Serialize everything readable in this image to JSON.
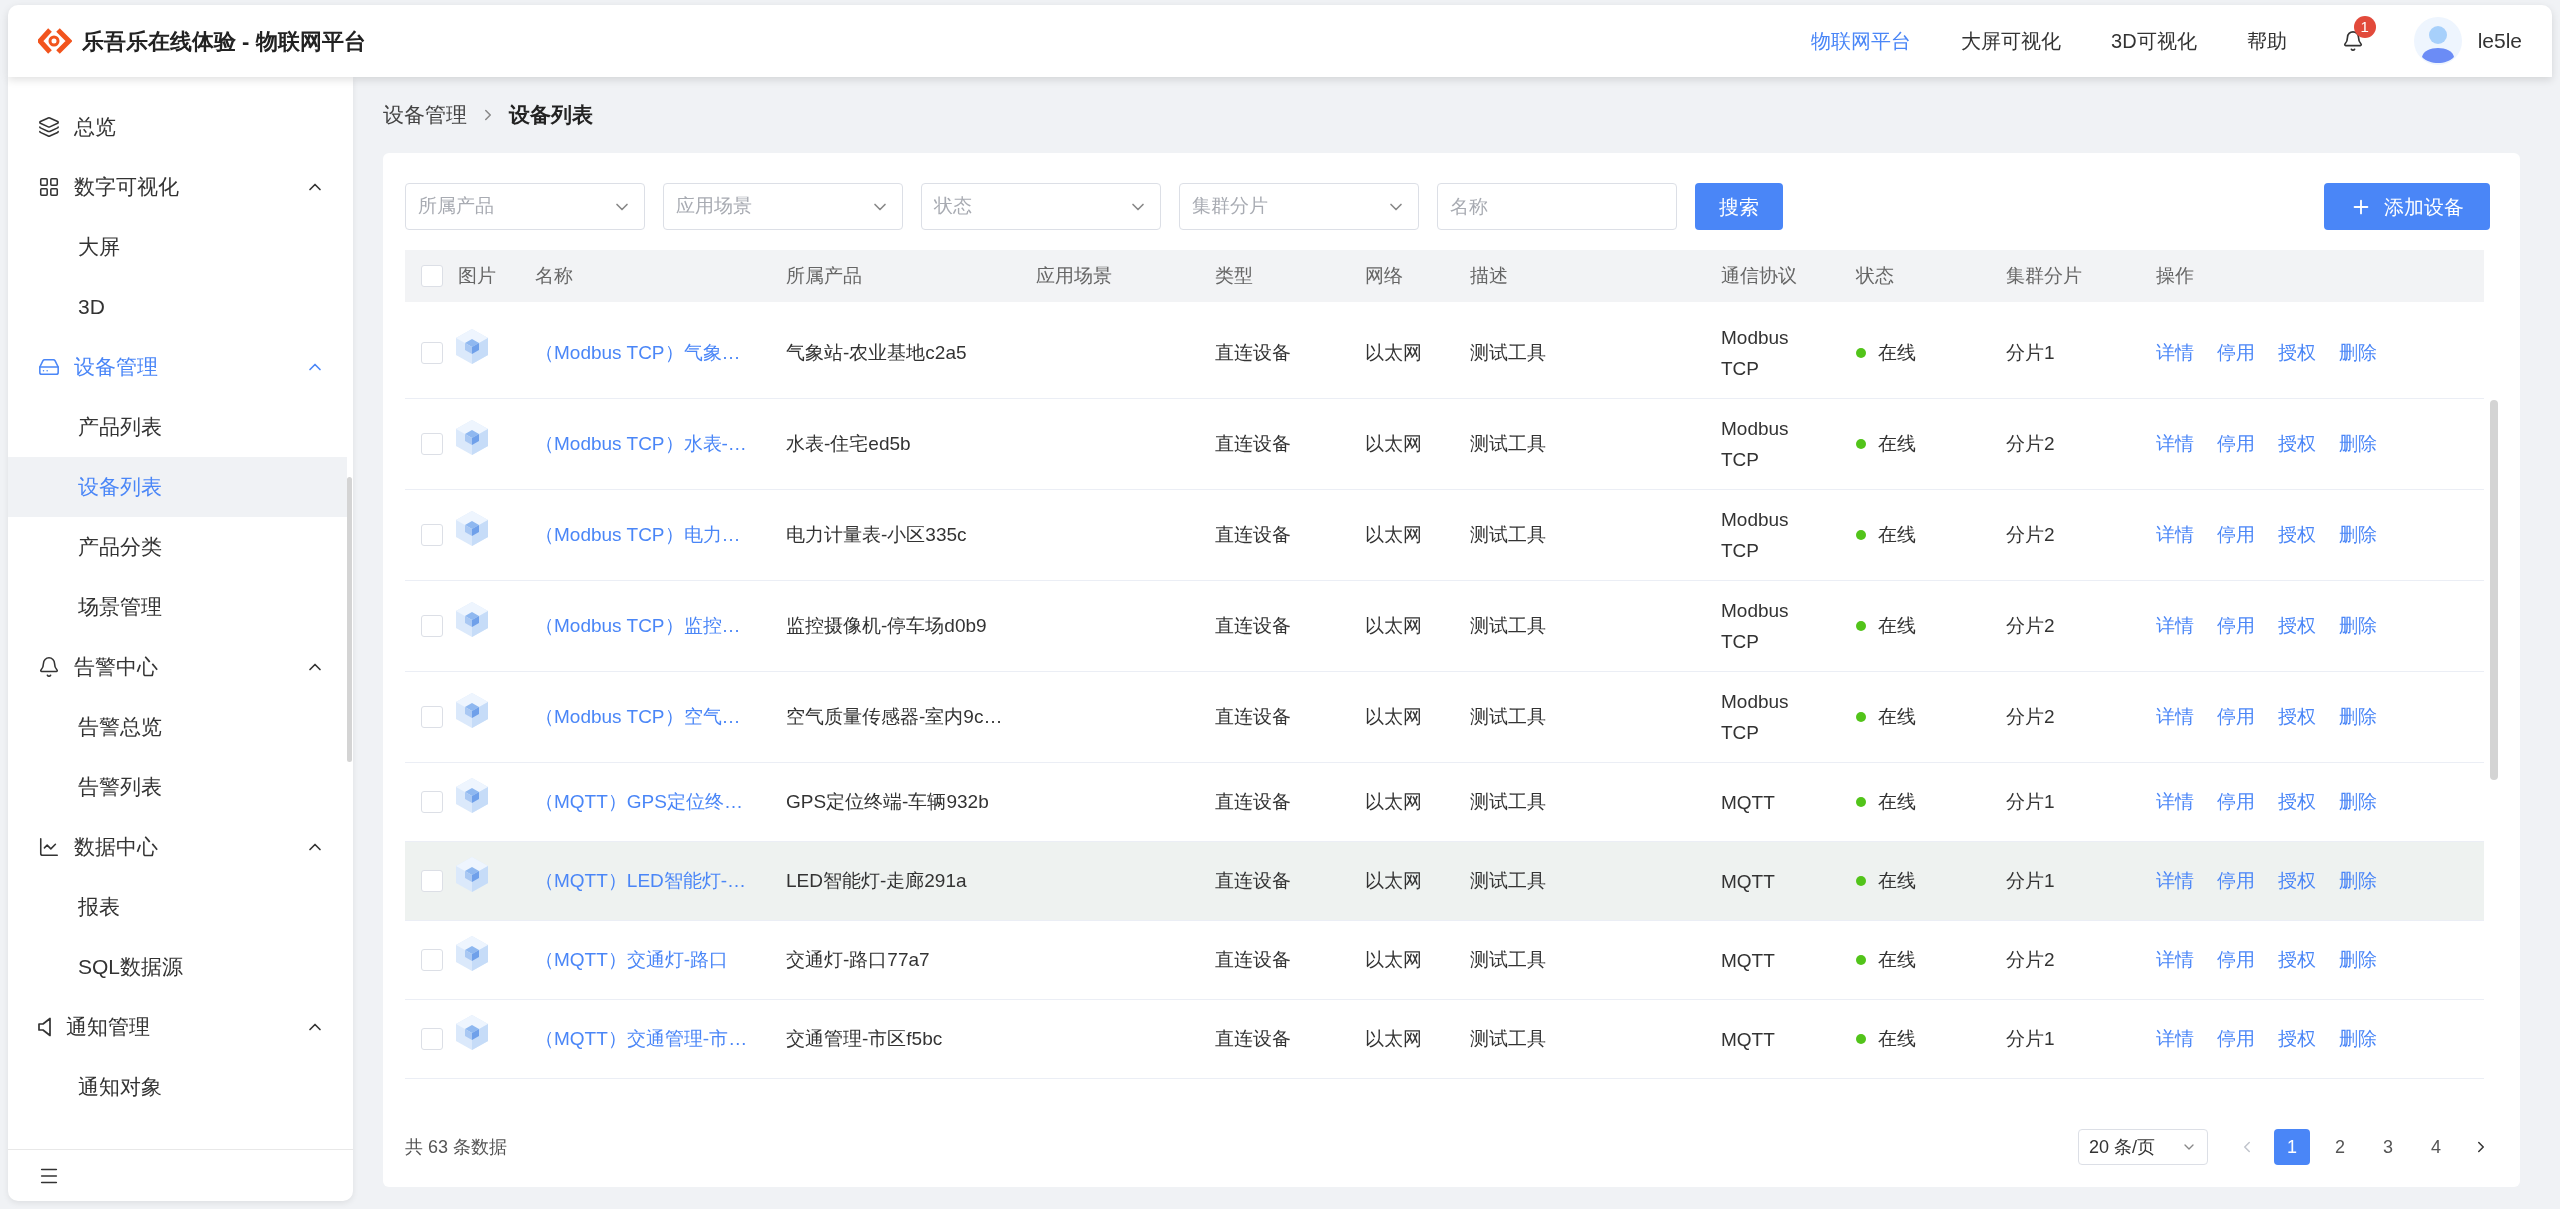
{
  "header": {
    "title": "乐吾乐在线体验 - 物联网平台",
    "nav": [
      {
        "label": "物联网平台",
        "selected": true
      },
      {
        "label": "大屏可视化",
        "selected": false
      },
      {
        "label": "3D可视化",
        "selected": false
      },
      {
        "label": "帮助",
        "selected": false
      }
    ],
    "notifications": "1",
    "user": "le5le"
  },
  "sidebar": {
    "items": [
      {
        "label": "总览",
        "selected": false
      },
      {
        "label": "数字可视化",
        "expanded": true,
        "selected": false,
        "children": [
          {
            "label": "大屏",
            "selected": false
          },
          {
            "label": "3D",
            "selected": false
          }
        ]
      },
      {
        "label": "设备管理",
        "expanded": true,
        "selected": true,
        "children": [
          {
            "label": "产品列表",
            "selected": false
          },
          {
            "label": "设备列表",
            "selected": true
          },
          {
            "label": "产品分类",
            "selected": false
          },
          {
            "label": "场景管理",
            "selected": false
          }
        ]
      },
      {
        "label": "告警中心",
        "expanded": true,
        "selected": false,
        "children": [
          {
            "label": "告警总览",
            "selected": false
          },
          {
            "label": "告警列表",
            "selected": false
          }
        ]
      },
      {
        "label": "数据中心",
        "expanded": true,
        "selected": false,
        "children": [
          {
            "label": "报表",
            "selected": false
          },
          {
            "label": "SQL数据源",
            "selected": false
          }
        ]
      },
      {
        "label": "通知管理",
        "expanded": true,
        "selected": false,
        "children": [
          {
            "label": "通知对象",
            "selected": false
          }
        ]
      }
    ]
  },
  "breadcrumb": [
    "设备管理",
    "设备列表"
  ],
  "filters": [
    {
      "kind": "select",
      "placeholder": "所属产品"
    },
    {
      "kind": "select",
      "placeholder": "应用场景"
    },
    {
      "kind": "select",
      "placeholder": "状态"
    },
    {
      "kind": "select",
      "placeholder": "集群分片"
    },
    {
      "kind": "input",
      "placeholder": "名称"
    }
  ],
  "search_button": "搜索",
  "add_button": "添加设备",
  "table": {
    "select_all_checked": false,
    "columns": [
      "图片",
      "名称",
      "所属产品",
      "应用场景",
      "类型",
      "网络",
      "描述",
      "通信协议",
      "状态",
      "集群分片",
      "操作"
    ],
    "rows": [
      {
        "name": "（Modbus TCP）气象…",
        "product": "气象站-农业基地c2a5",
        "type": "直连设备",
        "network": "以太网",
        "desc": "测试工具",
        "protocol": "Modbus TCP",
        "status": "在线",
        "shard": "分片1",
        "highlighted": false,
        "checked": false,
        "actions": [
          "详情",
          "停用",
          "授权",
          "删除"
        ]
      },
      {
        "name": "（Modbus TCP）水表-…",
        "product": "水表-住宅ed5b",
        "type": "直连设备",
        "network": "以太网",
        "desc": "测试工具",
        "protocol": "Modbus TCP",
        "status": "在线",
        "shard": "分片2",
        "highlighted": false,
        "checked": false,
        "actions": [
          "详情",
          "停用",
          "授权",
          "删除"
        ]
      },
      {
        "name": "（Modbus TCP）电力…",
        "product": "电力计量表-小区335c",
        "type": "直连设备",
        "network": "以太网",
        "desc": "测试工具",
        "protocol": "Modbus TCP",
        "status": "在线",
        "shard": "分片2",
        "highlighted": false,
        "checked": false,
        "actions": [
          "详情",
          "停用",
          "授权",
          "删除"
        ]
      },
      {
        "name": "（Modbus TCP）监控…",
        "product": "监控摄像机-停车场d0b9",
        "type": "直连设备",
        "network": "以太网",
        "desc": "测试工具",
        "protocol": "Modbus TCP",
        "status": "在线",
        "shard": "分片2",
        "highlighted": false,
        "checked": false,
        "actions": [
          "详情",
          "停用",
          "授权",
          "删除"
        ]
      },
      {
        "name": "（Modbus TCP）空气…",
        "product": "空气质量传感器-室内9c…",
        "type": "直连设备",
        "network": "以太网",
        "desc": "测试工具",
        "protocol": "Modbus TCP",
        "status": "在线",
        "shard": "分片2",
        "highlighted": false,
        "checked": false,
        "actions": [
          "详情",
          "停用",
          "授权",
          "删除"
        ]
      },
      {
        "name": "（MQTT）GPS定位终…",
        "product": "GPS定位终端-车辆932b",
        "type": "直连设备",
        "network": "以太网",
        "desc": "测试工具",
        "protocol": "MQTT",
        "status": "在线",
        "shard": "分片1",
        "highlighted": false,
        "checked": false,
        "actions": [
          "详情",
          "停用",
          "授权",
          "删除"
        ]
      },
      {
        "name": "（MQTT）LED智能灯-…",
        "product": "LED智能灯-走廊291a",
        "type": "直连设备",
        "network": "以太网",
        "desc": "测试工具",
        "protocol": "MQTT",
        "status": "在线",
        "shard": "分片1",
        "highlighted": true,
        "checked": false,
        "actions": [
          "详情",
          "停用",
          "授权",
          "删除"
        ]
      },
      {
        "name": "（MQTT）交通灯-路口",
        "product": "交通灯-路口77a7",
        "type": "直连设备",
        "network": "以太网",
        "desc": "测试工具",
        "protocol": "MQTT",
        "status": "在线",
        "shard": "分片2",
        "highlighted": false,
        "checked": false,
        "actions": [
          "详情",
          "停用",
          "授权",
          "删除"
        ]
      },
      {
        "name": "（MQTT）交通管理-市…",
        "product": "交通管理-市区f5bc",
        "type": "直连设备",
        "network": "以太网",
        "desc": "测试工具",
        "protocol": "MQTT",
        "status": "在线",
        "shard": "分片1",
        "highlighted": false,
        "checked": false,
        "actions": [
          "详情",
          "停用",
          "授权",
          "删除"
        ]
      }
    ]
  },
  "footer": {
    "total": "共 63 条数据",
    "page_size": "20 条/页",
    "pages": [
      {
        "label": "1",
        "selected": true
      },
      {
        "label": "2",
        "selected": false
      },
      {
        "label": "3",
        "selected": false
      },
      {
        "label": "4",
        "selected": false
      }
    ]
  }
}
